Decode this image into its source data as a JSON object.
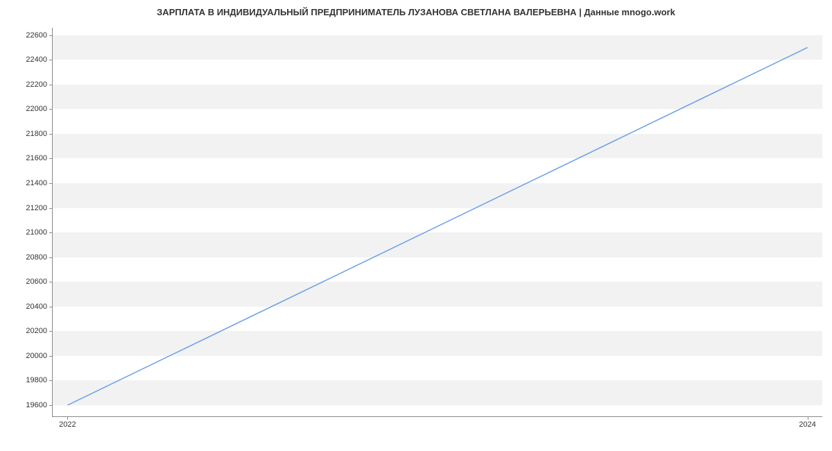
{
  "chart_data": {
    "type": "line",
    "title": "ЗАРПЛАТА В ИНДИВИДУАЛЬНЫЙ ПРЕДПРИНИМАТЕЛЬ ЛУЗАНОВА СВЕТЛАНА ВАЛЕРЬЕВНА | Данные mnogo.work",
    "x": [
      2022,
      2024
    ],
    "values": [
      19600,
      22500
    ],
    "xlabel": "",
    "ylabel": "",
    "x_ticks": [
      2022,
      2024
    ],
    "y_ticks": [
      19600,
      19800,
      20000,
      20200,
      20400,
      20600,
      20800,
      21000,
      21200,
      21400,
      21600,
      21800,
      22000,
      22200,
      22400,
      22600
    ],
    "ylim": [
      19510,
      22660
    ],
    "xlim": [
      2021.96,
      2024.04
    ],
    "line_color": "#6a9ee8"
  }
}
